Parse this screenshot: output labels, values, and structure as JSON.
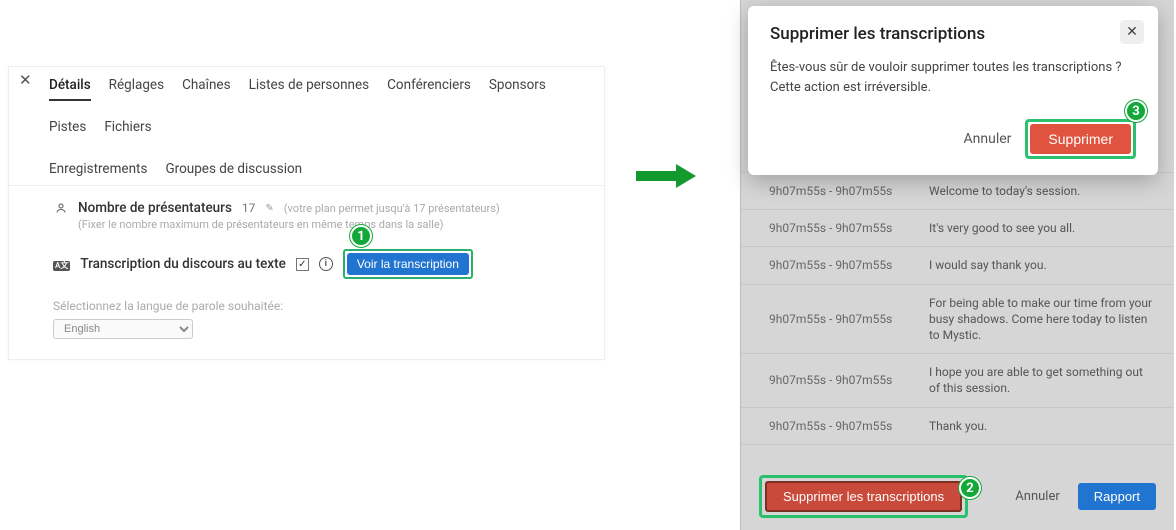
{
  "tabs": {
    "details": "Détails",
    "reglages": "Réglages",
    "chaines": "Chaînes",
    "listes": "Listes de personnes",
    "conferenciers": "Conférenciers",
    "sponsors": "Sponsors",
    "pistes": "Pistes",
    "fichiers": "Fichiers",
    "enregistrements": "Enregistrements",
    "groupes": "Groupes de discussion"
  },
  "presenters": {
    "label": "Nombre de présentateurs",
    "count": "17",
    "hint": "(votre plan permet jusqu'à 17 présentateurs)",
    "subhint": "(Fixer le nombre maximum de présentateurs en même temps dans la salle)"
  },
  "transcription": {
    "label": "Transcription du discours au texte",
    "view_button": "Voir la transcription",
    "lang_label": "Sélectionnez la langue de parole souhaitée:",
    "lang_value": "English"
  },
  "modal": {
    "title": "Supprimer les transcriptions",
    "line1": "Êtes-vous sûr de vouloir supprimer toutes les transcriptions ?",
    "line2": "Cette action est irréversible.",
    "cancel": "Annuler",
    "confirm": "Supprimer"
  },
  "transcript_rows": [
    {
      "time": "9h07m55s - 9h07m55s",
      "text": "Welcome to today's session."
    },
    {
      "time": "9h07m55s - 9h07m55s",
      "text": "It's very good to see you all."
    },
    {
      "time": "9h07m55s - 9h07m55s",
      "text": "I would say thank you."
    },
    {
      "time": "9h07m55s - 9h07m55s",
      "text": "For being able to make our time from your busy shadows. Come here today to listen to Mystic."
    },
    {
      "time": "9h07m55s - 9h07m55s",
      "text": "I hope you are able to get something out of this session."
    },
    {
      "time": "9h07m55s - 9h07m55s",
      "text": "Thank you."
    }
  ],
  "bottom": {
    "delete_all": "Supprimer les transcriptions",
    "cancel": "Annuler",
    "report": "Rapport"
  },
  "callouts": {
    "one": "1",
    "two": "2",
    "three": "3"
  }
}
